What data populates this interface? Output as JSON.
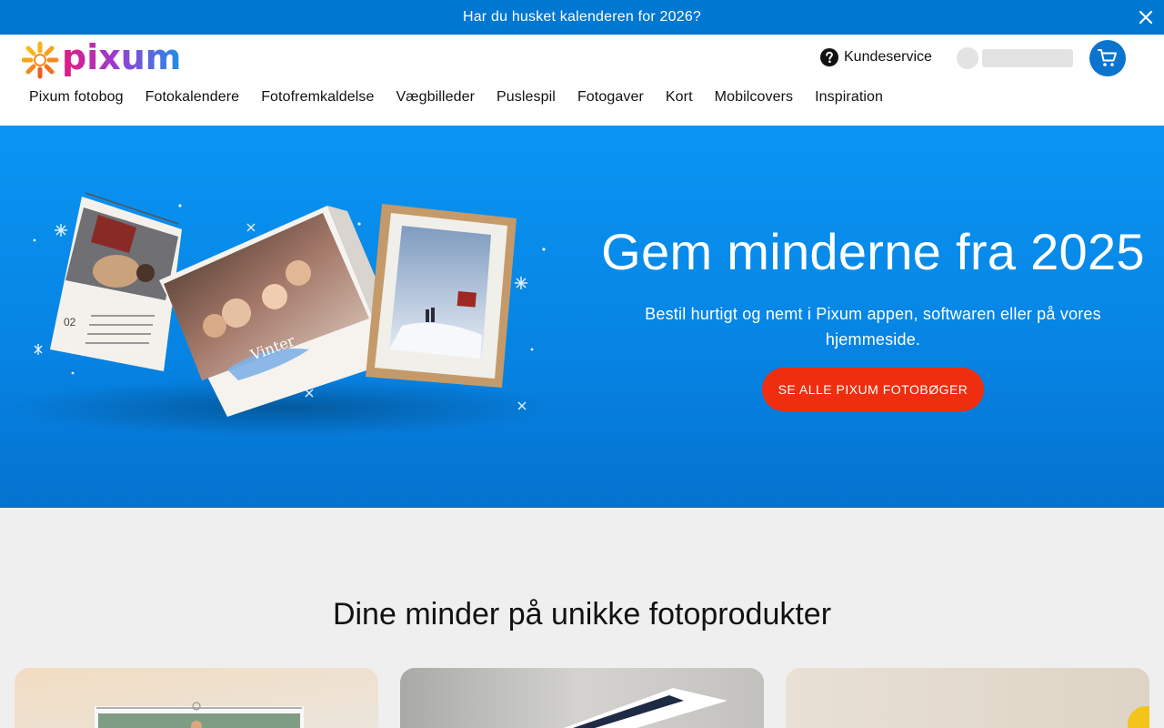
{
  "promo": {
    "text": "Har du husket kalenderen for 2026?",
    "close_icon": "close-icon"
  },
  "header": {
    "logo_text": "pixum",
    "customer_service": {
      "label": "Kundeservice",
      "icon": "help-icon"
    },
    "account": {
      "icon": "avatar"
    },
    "cart": {
      "icon": "cart-icon"
    }
  },
  "nav": [
    "Pixum fotobog",
    "Fotokalendere",
    "Fotofremkaldelse",
    "Vægbilleder",
    "Puslespil",
    "Fotogaver",
    "Kort",
    "Mobilcovers",
    "Inspiration"
  ],
  "hero": {
    "title": "Gem minderne fra 2025",
    "subtitle": "Bestil hurtigt og nemt i Pixum appen, softwaren eller på vores hjemmeside.",
    "cta": "SE ALLE PIXUM FOTOBØGER",
    "calendar_month": "02"
  },
  "products": {
    "title": "Dine minder på unikke fotoprodukter"
  },
  "colors": {
    "brand_blue": "#0b74cf",
    "cta_red": "#ee2e0f",
    "promo_bg": "#0077d0"
  }
}
